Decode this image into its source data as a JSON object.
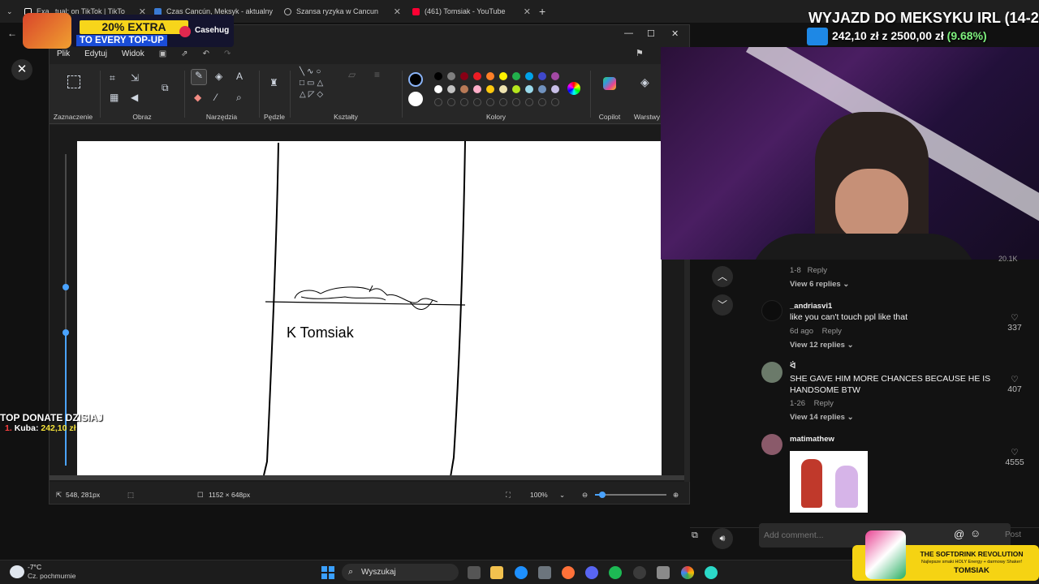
{
  "browser": {
    "tabs": [
      {
        "label": "Exa...tual; on TikTok | TikTo",
        "color": "#e6e6e6"
      },
      {
        "label": "Czas Cancún, Meksyk - aktualny",
        "color": "#3a7bd5"
      },
      {
        "label": "Szansa ryzyka w Cancun",
        "color": "#cfcfcf"
      },
      {
        "label": "(461) Tomsiak - YouTube",
        "color": "#ff0033"
      }
    ],
    "new_tab": "+",
    "close": "✕",
    "back": "←"
  },
  "promo": {
    "badge": "20% EXTRA",
    "sub": "TO EVERY TOP-UP",
    "brand": "Casehug"
  },
  "goal": {
    "title": "WYJAZD DO MEKSYKU IRL (14-28)",
    "current": "242,10 zł",
    "sep": "z",
    "target": "2500,00 zł",
    "percent": "(9.68%)",
    "fraction": 0.0968
  },
  "paint": {
    "menu": [
      "Plik",
      "Edytuj",
      "Widok"
    ],
    "groups": {
      "selection": "Zaznaczenie",
      "image": "Obraz",
      "tools": "Narzędzia",
      "brushes": "Pędzle",
      "shapes": "Kształty",
      "colors": "Kolory",
      "copilot": "Copilot",
      "layers": "Warstwy"
    },
    "tool_letter": "A",
    "swatch_colors": [
      "#000000",
      "#7f7f7f",
      "#880015",
      "#ed1c24",
      "#ff7f27",
      "#fff200",
      "#22b14c",
      "#00a2e8",
      "#3f48cc",
      "#a349a4",
      "#ffffff",
      "#c3c3c3",
      "#b97a57",
      "#ffaec9",
      "#ffc90e",
      "#efe4b0",
      "#b5e61d",
      "#99d9ea",
      "#7092be",
      "#c8bfe7"
    ],
    "canvas_text": "K Tomsiak",
    "status": {
      "cursor": "548, 281px",
      "size": "1152 × 648px",
      "zoom": "100%",
      "zoom_fraction": 0.1
    }
  },
  "overlay": {
    "top_donate_title": "TOP DONATE DZISIAJ",
    "top_donor_rank": "1.",
    "top_donor_name": "Kuba:",
    "top_donor_amount": "242,10 zł",
    "close": "✕"
  },
  "tiktok": {
    "comments": [
      {
        "name": "",
        "text": "",
        "meta_date": "1-8",
        "meta_reply": "Reply",
        "replies": "View 6 replies",
        "likes": ""
      },
      {
        "name": "_andriasvi1",
        "text": "like you can't touch ppl like that",
        "meta_date": "6d ago",
        "meta_reply": "Reply",
        "replies": "View 12 replies",
        "likes": "337"
      },
      {
        "name": "ᐛ",
        "text": "SHE GAVE HIM MORE CHANCES BECAUSE HE IS HANDSOME BTW",
        "meta_date": "1-26",
        "meta_reply": "Reply",
        "replies": "View 14 replies",
        "likes": "407"
      },
      {
        "name": "matimathew",
        "text": "",
        "meta_date": "",
        "meta_reply": "",
        "replies": "",
        "likes": "4555"
      }
    ],
    "add_comment_placeholder": "Add comment...",
    "mention": "@",
    "post": "Post",
    "top_likes": "20.1K"
  },
  "taskbar": {
    "weather_temp": "-7°C",
    "weather_desc": "Cz. pochmurnie",
    "search": "Wyszukaj"
  },
  "sponsor": {
    "title": "THE SOFTDRINK REVOLUTION",
    "sub": "Najlepsze smaki HOLY Energy + darmowy Shaker!",
    "name": "TOMSIAK"
  }
}
